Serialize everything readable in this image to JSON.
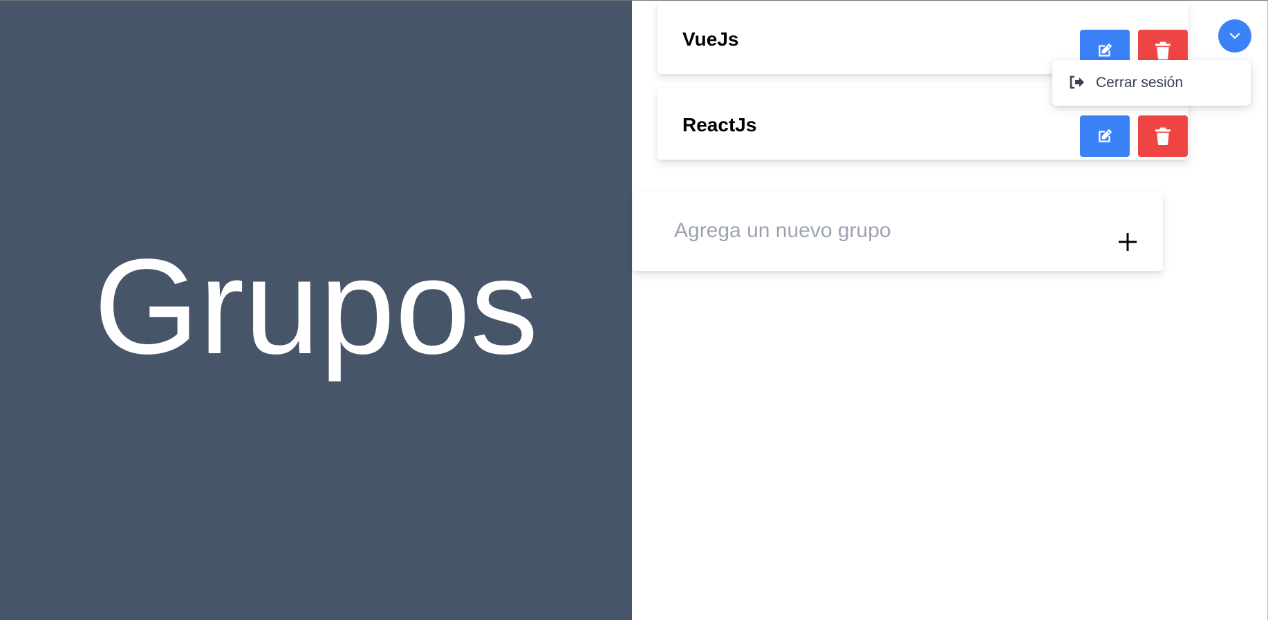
{
  "hero": {
    "title": "Grupos"
  },
  "groups": [
    {
      "name": "VueJs"
    },
    {
      "name": "ReactJs"
    }
  ],
  "new_group": {
    "placeholder": "Agrega un nuevo grupo",
    "value": ""
  },
  "user_menu": {
    "items": [
      {
        "label": "Cerrar sesión",
        "icon": "logout-icon"
      }
    ]
  },
  "colors": {
    "left_panel": "#475569",
    "edit_button": "#3b82f6",
    "delete_button": "#ef4444",
    "menu_toggle": "#3b82f6"
  }
}
